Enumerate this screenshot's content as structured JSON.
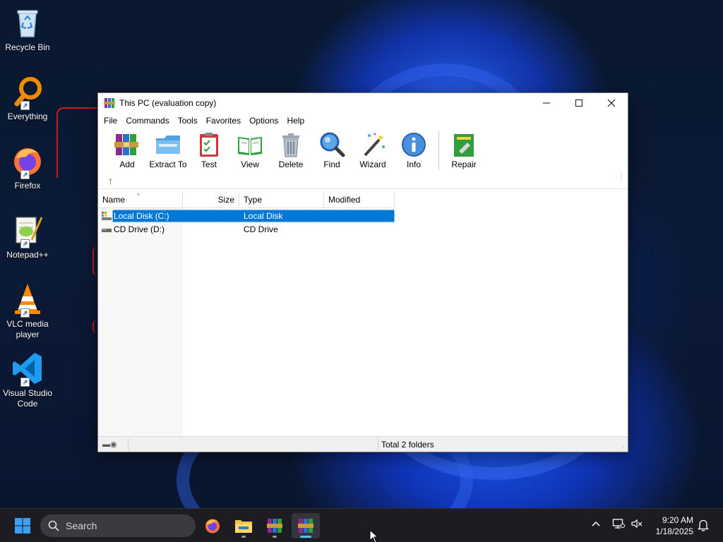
{
  "desktop": {
    "icons": [
      {
        "label": "Recycle Bin",
        "icon": "recycle-bin-icon"
      },
      {
        "label": "Everything",
        "icon": "everything-icon"
      },
      {
        "label": "Firefox",
        "icon": "firefox-icon"
      },
      {
        "label": "Notepad++",
        "icon": "notepad-plus-plus-icon"
      },
      {
        "label": "VLC media player",
        "icon": "vlc-icon"
      },
      {
        "label": "Visual Studio Code",
        "icon": "vscode-icon"
      }
    ]
  },
  "window": {
    "title": "This PC (evaluation copy)",
    "menu": [
      "File",
      "Commands",
      "Tools",
      "Favorites",
      "Options",
      "Help"
    ],
    "toolbar": [
      {
        "label": "Add",
        "icon": "add-archive-icon"
      },
      {
        "label": "Extract To",
        "icon": "extract-folder-icon"
      },
      {
        "label": "Test",
        "icon": "test-clipboard-icon"
      },
      {
        "label": "View",
        "icon": "view-book-icon"
      },
      {
        "label": "Delete",
        "icon": "trash-icon"
      },
      {
        "label": "Find",
        "icon": "magnifier-icon"
      },
      {
        "label": "Wizard",
        "icon": "wizard-wand-icon"
      },
      {
        "label": "Info",
        "icon": "info-icon"
      },
      {
        "label": "Repair",
        "icon": "repair-icon"
      }
    ],
    "columns": [
      "Name",
      "Size",
      "Type",
      "Modified"
    ],
    "rows": [
      {
        "name": "Local Disk (C:)",
        "size": "",
        "type": "Local Disk",
        "modified": "",
        "selected": true,
        "icon": "hard-drive-icon"
      },
      {
        "name": "CD Drive (D:)",
        "size": "",
        "type": "CD Drive",
        "modified": "",
        "selected": false,
        "icon": "cd-drive-icon"
      }
    ],
    "status": "Total 2 folders"
  },
  "taskbar": {
    "search_placeholder": "Search",
    "time": "9:20 AM",
    "date": "1/18/2025"
  },
  "colors": {
    "selection": "#0078d7",
    "taskbar": "#1c1c22"
  }
}
